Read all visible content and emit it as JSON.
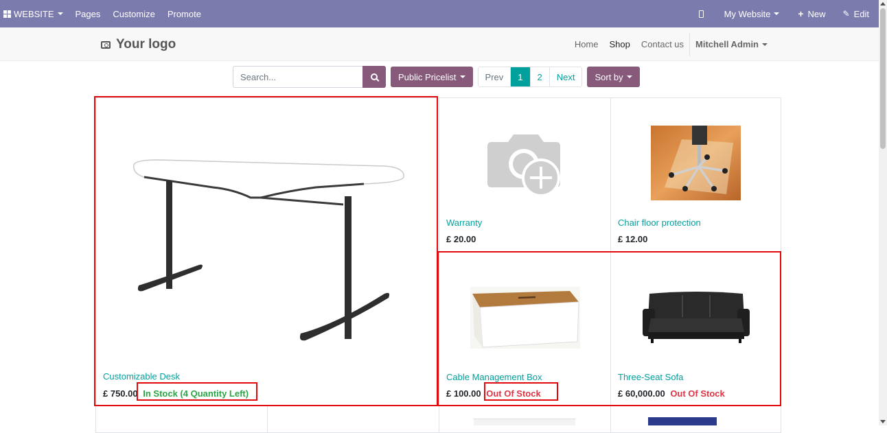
{
  "topbar": {
    "website_label": "WEBSITE",
    "menu": [
      "Pages",
      "Customize",
      "Promote"
    ],
    "my_website_label": "My Website",
    "new_label": "New",
    "edit_label": "Edit"
  },
  "header": {
    "logo_text": "Your logo",
    "nav": [
      "Home",
      "Shop",
      "Contact us"
    ],
    "active_nav": "Shop",
    "user_label": "Mitchell Admin"
  },
  "toolbar": {
    "search_placeholder": "Search...",
    "pricelist_label": "Public Pricelist",
    "pager": {
      "prev": "Prev",
      "pages": [
        "1",
        "2"
      ],
      "current": "1",
      "next": "Next"
    },
    "sort_label": "Sort by"
  },
  "products": [
    {
      "name": "Customizable Desk",
      "price": "£ 750.00",
      "stock": "In Stock (4 Quantity Left)",
      "stock_status": "in"
    },
    {
      "name": "Warranty",
      "price": "£ 20.00",
      "stock": "",
      "stock_status": "none"
    },
    {
      "name": "Chair floor protection",
      "price": "£ 12.00",
      "stock": "",
      "stock_status": "none"
    },
    {
      "name": "Cable Management Box",
      "price": "£ 100.00",
      "stock": "Out Of Stock",
      "stock_status": "out"
    },
    {
      "name": "Three-Seat Sofa",
      "price": "£ 60,000.00",
      "stock": "Out Of Stock",
      "stock_status": "out"
    }
  ],
  "colors": {
    "topbar": "#7c7bad",
    "primary": "#875a7b",
    "link": "#00a09d",
    "in_stock": "#28a745",
    "out_stock": "#dc3545",
    "highlight": "#e3080b"
  }
}
